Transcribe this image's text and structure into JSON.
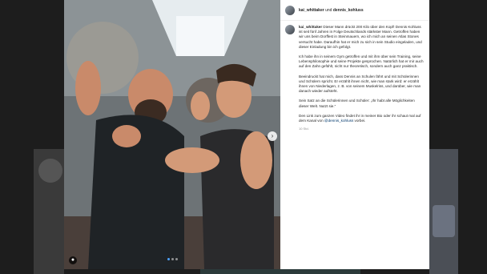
{
  "post": {
    "header_user": "kai_whittaker",
    "header_joiner": "und",
    "header_coauthor": "dennis_kohluss",
    "caption_user": "kai_whittaker",
    "paragraphs": [
      "Dieser Mann drückt 200 Kilo über den Kopf! Dennis Kohluss ist seit fünf Jahren in Folge Deutschlands stärkster Mann. Getroffen haben wir uns beim Dorffest in Steinmauern, wo ich mich an seinen Atlas Stones versucht habe. Daraufhin hat er mich zu sich in sein Studio eingeladen, und dieser Einladung bin ich gefolgt.",
      "Ich habe ihn in seinem Gym getroffen und mit ihm über sein Training, seine Lebensphilosophie und seine Projekte gesprochen. Natürlich hat er mir auch auf den Zahn gefühlt, nicht nur theoretisch, sondern auch ganz praktisch.",
      "Beeindruckt hat mich, dass Dennis an Schulen fährt und mit Schülerinnen und Schülern spricht. Er erzählt ihnen nicht, wie man stark wird: er erzählt ihnen von Niederlagen, z. B. von seinem Muskelriss, und darüber, wie man danach wieder aufsteht.",
      "Sein Satz an die Schülerinnen und Schüler: „Ihr habt alle Möglichkeiten dieser Welt. Nutzt sie.“"
    ],
    "last_para_before": "Den Link zum ganzen Video findet ihr in meiner Bio oder ihr schaut mal auf dem Kanal von ",
    "last_para_mention": "@dennis_kohluss",
    "last_para_after": " vorbei.",
    "timestamp": "10 Std."
  },
  "carousel": {
    "slides": 3,
    "active_index": 0
  },
  "colors": {
    "mention": "#00376b",
    "dot_active": "#4da3ff"
  }
}
